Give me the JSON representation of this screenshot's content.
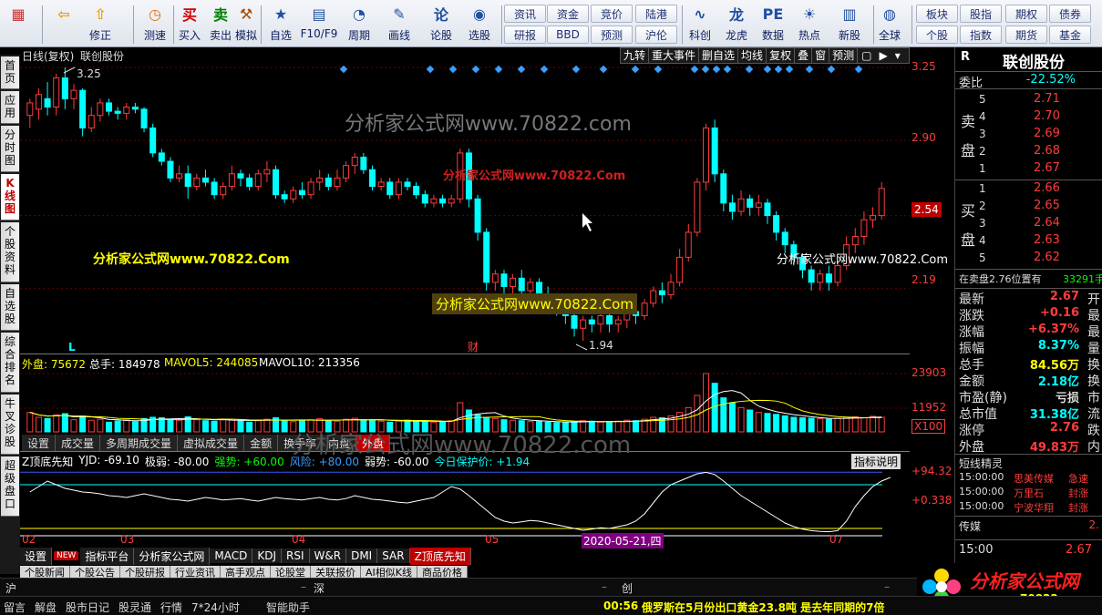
{
  "toolbar": {
    "main": [
      {
        "label": "",
        "icon": "grid-icon"
      },
      {
        "label": "",
        "icon": "back-arrow-icon"
      },
      {
        "label": "修正",
        "icon": "correct-icon"
      },
      {
        "label": "测速",
        "icon": "clock-icon"
      },
      {
        "label": "买入",
        "icon": "buy-icon"
      },
      {
        "label": "卖出",
        "icon": "sell-icon"
      },
      {
        "label": "模拟",
        "icon": "hammer-icon"
      },
      {
        "label": "自选",
        "icon": "star-icon"
      },
      {
        "label": "F10/F9",
        "icon": "doc-icon"
      },
      {
        "label": "周期",
        "icon": "cycle-icon"
      },
      {
        "label": "画线",
        "icon": "pen-icon"
      },
      {
        "label": "论股",
        "icon": "talk-icon"
      },
      {
        "label": "选股",
        "icon": "select-icon"
      },
      {
        "label": "科创",
        "icon": "kechuang-icon"
      },
      {
        "label": "龙虎",
        "icon": "dragon-icon"
      },
      {
        "label": "数据",
        "icon": "pe-icon"
      },
      {
        "label": "热点",
        "icon": "hot-icon"
      },
      {
        "label": "新股",
        "icon": "newstock-icon"
      },
      {
        "label": "全球",
        "icon": "globe-icon"
      }
    ],
    "small": [
      "资讯",
      "研报",
      "资金",
      "BBD",
      "竞价",
      "预测",
      "陆港",
      "沪伦",
      "板块",
      "个股",
      "股指",
      "指数",
      "期权",
      "期货",
      "债券",
      "基金"
    ]
  },
  "sidetabs": [
    "首页",
    "应用",
    "分时图",
    "K线图",
    "个股资料",
    "自选股",
    "综合排名",
    "牛叉诊股",
    "超级盘口"
  ],
  "chart": {
    "header_left": "日线(复权)",
    "stock_name_small": "联创股份",
    "buttons": [
      "九转",
      "重大事件",
      "删自选",
      "均线",
      "复权",
      "叠",
      "窗",
      "预测"
    ],
    "price_axis": [
      "3.25",
      "2.90",
      "2.54",
      "2.19"
    ],
    "current_price_tag": "2.54",
    "high_label": "3.25",
    "low_label": "1.94",
    "marker_L": "L",
    "marker_cai": "财",
    "volume_header": {
      "outer": "外盘: 75672",
      "total": "总手: 184978",
      "mavol5": "MAVOL5: 244085",
      "mavol10": "MAVOL10: 213356"
    },
    "volume_axis": [
      "23903",
      "11952",
      "X100"
    ],
    "vol_tabs": [
      "设置",
      "成交量",
      "多周期成交量",
      "虚拟成交量",
      "金额",
      "换手率",
      "内盘",
      "外盘"
    ],
    "indicator_header": {
      "name": "Z顶底先知",
      "yjd": "YJD: -69.10",
      "jr": "极弱: -80.00",
      "qs": "强势: +60.00",
      "fx": "风险: +80.00",
      "rs": "弱势: -60.00",
      "jr2": "今日保护价: +1.94"
    },
    "indicator_help": "指标说明",
    "indicator_axis": [
      "+94.32",
      "+0.338"
    ],
    "date_axis": [
      "02",
      "03",
      "04",
      "05",
      "07"
    ],
    "date_highlight": "2020-05-21,四",
    "ind_tabs": [
      "设置",
      "指标平台",
      "分析家公式网",
      "MACD",
      "KDJ",
      "RSI",
      "W&R",
      "DMI",
      "SAR",
      "Z顶底先知"
    ],
    "new_badge": "NEW",
    "news_tabs": [
      "个股新闻",
      "个股公告",
      "个股研报",
      "行业资讯",
      "高手观点",
      "论股堂",
      "关联报价",
      "AI相似K线",
      "商品价格"
    ]
  },
  "watermarks": [
    "分析家公式网www.70822.com",
    "分析家公式网www.70822.Com",
    "分析家公式网www.70822.Com",
    "分析家公式网www.70822.Com",
    "分析家公式网www.70822.Com",
    "分析家公式网www.70822.com"
  ],
  "rpanel": {
    "r": "R",
    "stock_name": "联创股份",
    "weibi_label": "委比",
    "weibi_value": "-22.52%",
    "sell_label": [
      "卖",
      "盘"
    ],
    "buy_label": [
      "买",
      "盘"
    ],
    "sells": [
      {
        "n": "5",
        "p": "2.71"
      },
      {
        "n": "4",
        "p": "2.70"
      },
      {
        "n": "3",
        "p": "2.69"
      },
      {
        "n": "2",
        "p": "2.68"
      },
      {
        "n": "1",
        "p": "2.67"
      }
    ],
    "buys": [
      {
        "n": "1",
        "p": "2.66"
      },
      {
        "n": "2",
        "p": "2.65"
      },
      {
        "n": "3",
        "p": "2.64"
      },
      {
        "n": "4",
        "p": "2.63"
      },
      {
        "n": "5",
        "p": "2.62"
      }
    ],
    "pending": "在卖盘2.76位置有",
    "pending_qty": "33291手",
    "stats": [
      {
        "k": "最新",
        "v": "2.67",
        "e": "开",
        "c": "#ff3c3c"
      },
      {
        "k": "涨跌",
        "v": "+0.16",
        "e": "最",
        "c": "#ff3c3c"
      },
      {
        "k": "涨幅",
        "v": "+6.37%",
        "e": "最",
        "c": "#ff3c3c"
      },
      {
        "k": "振幅",
        "v": "8.37%",
        "e": "量",
        "c": "#00ffff"
      },
      {
        "k": "总手",
        "v": "84.56万",
        "e": "换",
        "c": "#ffff00"
      },
      {
        "k": "金额",
        "v": "2.18亿",
        "e": "换",
        "c": "#00ffff"
      },
      {
        "k": "市盈(静)",
        "v": "亏损",
        "e": "市",
        "c": "#dddddd"
      },
      {
        "k": "总市值",
        "v": "31.38亿",
        "e": "流",
        "c": "#00ffff"
      },
      {
        "k": "涨停",
        "v": "2.76",
        "e": "跌",
        "c": "#ff3c3c"
      },
      {
        "k": "外盘",
        "v": "49.83万",
        "e": "内",
        "c": "#ff3c3c"
      }
    ],
    "short_title": "短线精灵",
    "short": [
      {
        "t": "15:00:00",
        "n": "思美传媒",
        "s": "急速"
      },
      {
        "t": "15:00:00",
        "n": "万里石",
        "s": "封涨"
      },
      {
        "t": "15:00:00",
        "n": "宁波华翔",
        "s": "封涨"
      }
    ],
    "sector": "传媒",
    "sector_val": "2.",
    "time": "15:00",
    "time_price": "2.67"
  },
  "status": {
    "sh": "沪",
    "sz": "深",
    "cy": "创"
  },
  "bottombar": {
    "items": [
      "留言",
      "解盘",
      "股市日记",
      "股灵通",
      "行情",
      "7*24小时",
      "智能助手"
    ],
    "ticker_time": "00:56",
    "ticker": "俄罗斯在5月份出口黄金23.8吨 是去年同期的7倍",
    "logo": "分析家公式网",
    "logo_url": "www.70822.com"
  },
  "colors": {
    "up": "#ff3c3c",
    "down": "#00ffff",
    "grid": "#6a0000",
    "axis_text": "#ff3c3c",
    "yellow": "#ffff00"
  },
  "chart_data": {
    "type": "candlestick",
    "ylim": [
      1.94,
      3.25
    ],
    "candles": [
      [
        3.02,
        3.08,
        2.96,
        3.1
      ],
      [
        3.05,
        3.12,
        3.0,
        3.15
      ],
      [
        3.1,
        3.06,
        3.02,
        3.18
      ],
      [
        3.06,
        3.2,
        3.02,
        3.22
      ],
      [
        3.2,
        3.1,
        3.05,
        3.25
      ],
      [
        3.1,
        3.14,
        3.05,
        3.17
      ],
      [
        3.14,
        2.96,
        2.92,
        3.15
      ],
      [
        2.96,
        3.02,
        2.94,
        3.06
      ],
      [
        3.02,
        3.08,
        2.99,
        3.1
      ],
      [
        3.08,
        3.04,
        3.02,
        3.1
      ],
      [
        3.04,
        3.03,
        3.0,
        3.06
      ],
      [
        3.03,
        3.06,
        3.0,
        3.08
      ],
      [
        3.06,
        3.05,
        3.03,
        3.08
      ],
      [
        3.05,
        2.96,
        2.94,
        3.06
      ],
      [
        2.96,
        2.84,
        2.82,
        2.98
      ],
      [
        2.84,
        2.8,
        2.78,
        2.86
      ],
      [
        2.8,
        2.72,
        2.7,
        2.82
      ],
      [
        2.72,
        2.74,
        2.7,
        2.78
      ],
      [
        2.74,
        2.68,
        2.62,
        2.78
      ],
      [
        2.68,
        2.72,
        2.66,
        2.74
      ],
      [
        2.72,
        2.7,
        2.68,
        2.76
      ],
      [
        2.7,
        2.64,
        2.62,
        2.72
      ],
      [
        2.64,
        2.68,
        2.62,
        2.7
      ],
      [
        2.68,
        2.74,
        2.66,
        2.78
      ],
      [
        2.74,
        2.72,
        2.68,
        2.76
      ],
      [
        2.72,
        2.68,
        2.66,
        2.74
      ],
      [
        2.68,
        2.74,
        2.66,
        2.76
      ],
      [
        2.74,
        2.76,
        2.7,
        2.8
      ],
      [
        2.76,
        2.64,
        2.62,
        2.78
      ],
      [
        2.64,
        2.62,
        2.6,
        2.66
      ],
      [
        2.62,
        2.66,
        2.6,
        2.68
      ],
      [
        2.66,
        2.64,
        2.62,
        2.7
      ],
      [
        2.64,
        2.7,
        2.62,
        2.72
      ],
      [
        2.7,
        2.72,
        2.66,
        2.76
      ],
      [
        2.72,
        2.68,
        2.66,
        2.74
      ],
      [
        2.68,
        2.72,
        2.66,
        2.76
      ],
      [
        2.72,
        2.78,
        2.7,
        2.8
      ],
      [
        2.78,
        2.82,
        2.74,
        2.84
      ],
      [
        2.82,
        2.76,
        2.74,
        2.84
      ],
      [
        2.76,
        2.68,
        2.66,
        2.78
      ],
      [
        2.68,
        2.7,
        2.66,
        2.72
      ],
      [
        2.7,
        2.64,
        2.62,
        2.72
      ],
      [
        2.64,
        2.7,
        2.62,
        2.72
      ],
      [
        2.7,
        2.68,
        2.66,
        2.72
      ],
      [
        2.68,
        2.64,
        2.62,
        2.7
      ],
      [
        2.64,
        2.6,
        2.58,
        2.66
      ],
      [
        2.6,
        2.62,
        2.58,
        2.64
      ],
      [
        2.62,
        2.6,
        2.58,
        2.64
      ],
      [
        2.6,
        2.62,
        2.58,
        2.64
      ],
      [
        2.62,
        2.84,
        2.6,
        2.86
      ],
      [
        2.84,
        2.62,
        2.58,
        2.86
      ],
      [
        2.62,
        2.46,
        2.42,
        2.64
      ],
      [
        2.46,
        2.22,
        2.18,
        2.48
      ],
      [
        2.22,
        2.26,
        2.18,
        2.28
      ],
      [
        2.26,
        2.2,
        2.16,
        2.28
      ],
      [
        2.2,
        2.24,
        2.16,
        2.26
      ],
      [
        2.24,
        2.18,
        2.16,
        2.28
      ],
      [
        2.18,
        2.22,
        2.14,
        2.24
      ],
      [
        2.22,
        2.16,
        2.12,
        2.24
      ],
      [
        2.16,
        2.14,
        2.1,
        2.2
      ],
      [
        2.14,
        2.1,
        2.06,
        2.16
      ],
      [
        2.1,
        2.06,
        2.02,
        2.12
      ],
      [
        2.06,
        2.0,
        1.96,
        2.08
      ],
      [
        2.0,
        2.04,
        1.94,
        2.06
      ],
      [
        2.04,
        2.02,
        1.98,
        2.06
      ],
      [
        2.02,
        2.06,
        1.98,
        2.08
      ],
      [
        2.06,
        2.02,
        1.98,
        2.08
      ],
      [
        2.02,
        2.04,
        1.98,
        2.06
      ],
      [
        2.04,
        2.08,
        2.0,
        2.1
      ],
      [
        2.08,
        2.06,
        2.02,
        2.12
      ],
      [
        2.06,
        2.12,
        2.04,
        2.14
      ],
      [
        2.12,
        2.18,
        2.1,
        2.2
      ],
      [
        2.18,
        2.16,
        2.12,
        2.22
      ],
      [
        2.16,
        2.22,
        2.14,
        2.26
      ],
      [
        2.22,
        2.34,
        2.2,
        2.38
      ],
      [
        2.34,
        2.46,
        2.32,
        2.5
      ],
      [
        2.46,
        2.7,
        2.44,
        2.72
      ],
      [
        2.7,
        2.96,
        2.66,
        2.98
      ],
      [
        2.96,
        2.74,
        2.7,
        3.0
      ],
      [
        2.74,
        2.6,
        2.56,
        2.76
      ],
      [
        2.6,
        2.56,
        2.52,
        2.64
      ],
      [
        2.56,
        2.62,
        2.54,
        2.66
      ],
      [
        2.62,
        2.58,
        2.54,
        2.64
      ],
      [
        2.58,
        2.6,
        2.54,
        2.64
      ],
      [
        2.6,
        2.54,
        2.5,
        2.62
      ],
      [
        2.54,
        2.46,
        2.42,
        2.56
      ],
      [
        2.46,
        2.4,
        2.36,
        2.48
      ],
      [
        2.4,
        2.34,
        2.3,
        2.42
      ],
      [
        2.34,
        2.28,
        2.24,
        2.36
      ],
      [
        2.28,
        2.22,
        2.18,
        2.3
      ],
      [
        2.22,
        2.26,
        2.18,
        2.28
      ],
      [
        2.26,
        2.22,
        2.18,
        2.3
      ],
      [
        2.22,
        2.3,
        2.2,
        2.32
      ],
      [
        2.3,
        2.4,
        2.28,
        2.44
      ],
      [
        2.4,
        2.44,
        2.36,
        2.48
      ],
      [
        2.44,
        2.52,
        2.4,
        2.56
      ],
      [
        2.52,
        2.54,
        2.48,
        2.58
      ],
      [
        2.54,
        2.67,
        2.52,
        2.7
      ]
    ],
    "volumes": [
      80,
      60,
      55,
      70,
      75,
      50,
      65,
      48,
      52,
      40,
      45,
      50,
      42,
      55,
      60,
      58,
      52,
      48,
      62,
      50,
      46,
      44,
      50,
      52,
      48,
      40,
      46,
      52,
      58,
      45,
      42,
      48,
      50,
      54,
      46,
      44,
      52,
      56,
      50,
      48,
      44,
      40,
      46,
      48,
      42,
      44,
      40,
      42,
      46,
      120,
      90,
      70,
      60,
      55,
      50,
      48,
      46,
      42,
      44,
      40,
      38,
      40,
      42,
      46,
      44,
      40,
      42,
      44,
      48,
      46,
      52,
      60,
      58,
      66,
      80,
      100,
      150,
      240,
      200,
      140,
      120,
      100,
      90,
      80,
      76,
      72,
      66,
      60,
      58,
      56,
      54,
      52,
      56,
      60,
      62,
      58,
      64,
      60
    ],
    "indicator": [
      40,
      55,
      70,
      60,
      50,
      45,
      40,
      38,
      35,
      30,
      28,
      25,
      30,
      35,
      30,
      25,
      20,
      18,
      15,
      20,
      25,
      22,
      18,
      20,
      22,
      18,
      15,
      20,
      25,
      22,
      20,
      18,
      22,
      25,
      20,
      18,
      22,
      30,
      25,
      20,
      18,
      15,
      12,
      10,
      15,
      20,
      25,
      40,
      55,
      48,
      30,
      10,
      -10,
      -30,
      -40,
      -45,
      -42,
      -38,
      -40,
      -45,
      -50,
      -55,
      -60,
      -65,
      -62,
      -58,
      -60,
      -55,
      -50,
      -40,
      -20,
      10,
      40,
      60,
      70,
      80,
      90,
      94,
      88,
      70,
      50,
      30,
      15,
      0,
      -15,
      -30,
      -45,
      -55,
      -62,
      -66,
      -68,
      -69,
      -66,
      -40,
      0,
      30,
      55,
      70,
      80
    ]
  }
}
